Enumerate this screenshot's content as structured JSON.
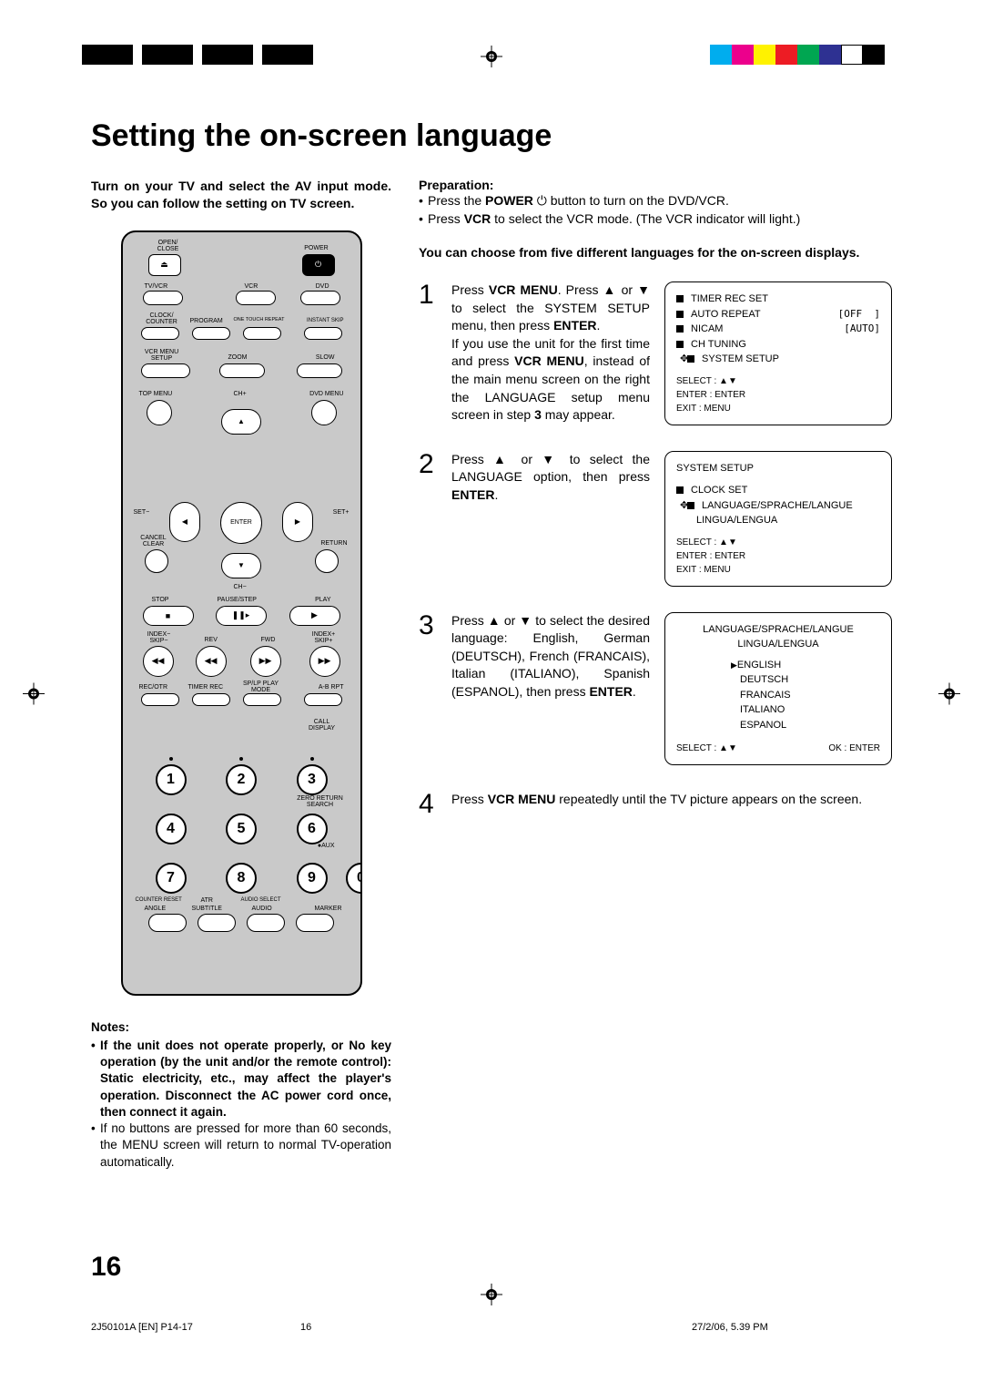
{
  "title": "Setting the on-screen language",
  "intro_left": "Turn on your TV and select the AV input mode. So you can follow the setting on TV screen.",
  "prep": {
    "heading": "Preparation:",
    "items": [
      "Press the POWER ⏻ button to turn on the DVD/VCR.",
      "Press VCR to select the VCR mode. (The VCR indicator will light.)"
    ],
    "b1": "POWER",
    "b2": "VCR"
  },
  "choose": "You can choose from five different languages for the on-screen displays.",
  "steps": {
    "s1": {
      "num": "1",
      "t1": "Press ",
      "b1": "VCR MENU",
      "t2": ". Press ▲ or ▼ to select the SYSTEM SETUP menu, then press ",
      "b2": "ENTER",
      "t3": ".",
      "t4": "If you use the unit for the first time and press ",
      "b3": "VCR MENU",
      "t5": ", instead of the main menu screen on the right the LANGUAGE setup menu screen in step ",
      "b4": "3",
      "t6": " may appear."
    },
    "s2": {
      "num": "2",
      "t1": "Press ▲ or ▼ to select the LANGUAGE option, then press ",
      "b1": "ENTER",
      "t2": "."
    },
    "s3": {
      "num": "3",
      "t1": "Press ▲ or ▼ to select the desired language: English, German (DEUTSCH), French (FRANCAIS), Italian (ITALIANO), Spanish (ESPANOL), then press ",
      "b1": "ENTER",
      "t2": "."
    },
    "s4": {
      "num": "4",
      "t1": "Press ",
      "b1": "VCR MENU",
      "t2": " repeatedly until the TV picture appears on the screen."
    }
  },
  "osd1": {
    "l1": "TIMER  REC  SET",
    "l2": "AUTO  REPEAT",
    "l2v": "OFF",
    "l3": "NICAM",
    "l3v": "AUTO",
    "l4": "CH TUNING",
    "l5": "SYSTEM  SETUP",
    "f1": "SELECT : ▲▼",
    "f2": "ENTER   : ENTER",
    "f3": "EXIT       : MENU"
  },
  "osd2": {
    "title": "SYSTEM  SETUP",
    "l1": "CLOCK  SET",
    "l2": "LANGUAGE/SPRACHE/LANGUE",
    "l3": "LINGUA/LENGUA",
    "f1": "SELECT : ▲▼",
    "f2": "ENTER   : ENTER",
    "f3": "EXIT       : MENU"
  },
  "osd3": {
    "title": "LANGUAGE/SPRACHE/LANGUE",
    "sub": "LINGUA/LENGUA",
    "opts": [
      "ENGLISH",
      "DEUTSCH",
      "FRANCAIS",
      "ITALIANO",
      "ESPANOL"
    ],
    "fL": "SELECT : ▲▼",
    "fR": "OK : ENTER"
  },
  "notes": {
    "heading": "Notes:",
    "n1": "If the unit does not operate properly, or No key operation (by the unit and/or the remote control): Static electricity, etc., may affect the player's operation. Disconnect the AC power cord once, then connect it again.",
    "n2": "If no buttons are pressed for more than 60 seconds, the MENU screen will return to normal TV-operation automatically."
  },
  "remote": {
    "open_close": "OPEN/\nCLOSE",
    "power": "POWER",
    "tvvcr": "TV/VCR",
    "vcr": "VCR",
    "dvd": "DVD",
    "clock_counter": "CLOCK/\nCOUNTER",
    "program": "PROGRAM",
    "otr": "ONE TOUCH REPEAT",
    "iskip": "INSTANT SKIP",
    "vcr_menu": "VCR MENU\nSETUP",
    "zoom": "ZOOM",
    "slow": "SLOW",
    "top_menu": "TOP MENU",
    "chp": "CH+",
    "dvd_menu": "DVD MENU",
    "setm": "SET−",
    "enter": "ENTER",
    "setp": "SET+",
    "cancel": "CANCEL\nCLEAR",
    "return": "RETURN",
    "chm": "CH−",
    "stop": "STOP",
    "pause": "PAUSE/STEP",
    "play": "PLAY",
    "idxm": "INDEX−\nSKIP−",
    "rev": "REV",
    "fwd": "FWD",
    "idxp": "INDEX+\nSKIP+",
    "recotr": "REC/OTR",
    "timerrec": "TIMER REC",
    "splp": "SP/LP\nPLAY MODE",
    "abrpt": "A-B RPT",
    "call": "CALL\nDISPLAY",
    "zeroret": "ZERO RETURN\nSEARCH",
    "aux": "●AUX",
    "cr": "COUNTER RESET",
    "atr": "ATR",
    "asel": "AUDIO SELECT",
    "angle": "ANGLE",
    "subtitle": "SUBTITLE",
    "audio": "AUDIO",
    "marker": "MARKER"
  },
  "pagenum": "16",
  "footer": {
    "l": "2J50101A [EN] P14-17",
    "c": "16",
    "r": "27/2/06, 5.39 PM"
  }
}
